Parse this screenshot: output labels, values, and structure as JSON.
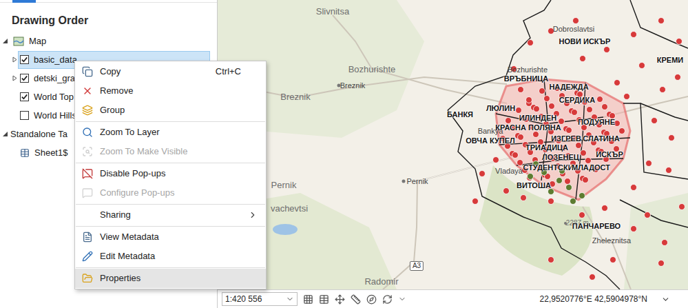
{
  "contents": {
    "title": "Drawing Order",
    "items": [
      {
        "label": "Map",
        "kind": "map",
        "level": 0,
        "expandable": true,
        "expanded": true,
        "selected": false
      },
      {
        "label": "basic_data",
        "kind": "layer",
        "level": 1,
        "expandable": true,
        "expanded": false,
        "checked": true,
        "selected": true
      },
      {
        "label": "detski_grad",
        "kind": "layer",
        "level": 1,
        "expandable": true,
        "expanded": false,
        "checked": true,
        "selected": false
      },
      {
        "label": "World Top",
        "kind": "layer",
        "level": 1,
        "expandable": false,
        "expanded": false,
        "checked": true,
        "selected": false
      },
      {
        "label": "World Hills",
        "kind": "layer",
        "level": 1,
        "expandable": false,
        "expanded": false,
        "checked": false,
        "selected": false
      },
      {
        "label": "Standalone Ta",
        "kind": "group",
        "level": 0,
        "expandable": true,
        "expanded": true,
        "selected": false
      },
      {
        "label": "Sheet1$",
        "kind": "table",
        "level": 1,
        "expandable": false,
        "expanded": false,
        "selected": false
      }
    ]
  },
  "context_menu": {
    "items": [
      {
        "label": "Copy",
        "shortcut": "Ctrl+C",
        "disabled": false,
        "submenu": false,
        "separator_before": false,
        "highlighted": false
      },
      {
        "label": "Remove",
        "shortcut": "",
        "disabled": false,
        "submenu": false,
        "separator_before": false,
        "highlighted": false
      },
      {
        "label": "Group",
        "shortcut": "",
        "disabled": false,
        "submenu": false,
        "separator_before": false,
        "highlighted": false
      },
      {
        "label": "Zoom To Layer",
        "shortcut": "",
        "disabled": false,
        "submenu": false,
        "separator_before": true,
        "highlighted": false
      },
      {
        "label": "Zoom To Make Visible",
        "shortcut": "",
        "disabled": true,
        "submenu": false,
        "separator_before": false,
        "highlighted": false
      },
      {
        "label": "Disable Pop-ups",
        "shortcut": "",
        "disabled": false,
        "submenu": false,
        "separator_before": true,
        "highlighted": false
      },
      {
        "label": "Configure Pop-ups",
        "shortcut": "",
        "disabled": true,
        "submenu": false,
        "separator_before": false,
        "highlighted": false
      },
      {
        "label": "Sharing",
        "shortcut": "",
        "disabled": false,
        "submenu": true,
        "separator_before": true,
        "highlighted": false
      },
      {
        "label": "View Metadata",
        "shortcut": "",
        "disabled": false,
        "submenu": false,
        "separator_before": true,
        "highlighted": false
      },
      {
        "label": "Edit Metadata",
        "shortcut": "",
        "disabled": false,
        "submenu": false,
        "separator_before": false,
        "highlighted": false
      },
      {
        "label": "Properties",
        "shortcut": "",
        "disabled": false,
        "submenu": false,
        "separator_before": true,
        "highlighted": true
      }
    ]
  },
  "map": {
    "labels": [
      {
        "text": "Slivnitsa",
        "kind": "region"
      },
      {
        "text": "Dobroslavtsi",
        "kind": "town"
      },
      {
        "text": "НОВИ ИСКЪР",
        "kind": "district"
      },
      {
        "text": "КРЕМИ",
        "kind": "district"
      },
      {
        "text": "Bozhurishte",
        "kind": "region"
      },
      {
        "text": "Breznik",
        "kind": "town"
      },
      {
        "text": "Bozhurishte",
        "kind": "town"
      },
      {
        "text": "ВРЪБНИЦА",
        "kind": "district"
      },
      {
        "text": "НАДЕЖДА",
        "kind": "district"
      },
      {
        "text": "Breznik",
        "kind": "region"
      },
      {
        "text": "СЕРДИКА",
        "kind": "district"
      },
      {
        "text": "ЛЮЛИН",
        "kind": "district"
      },
      {
        "text": "БАНКЯ",
        "kind": "district"
      },
      {
        "text": "ИЛИНДЕН",
        "kind": "district"
      },
      {
        "text": "ПОДУЯНЕ",
        "kind": "district"
      },
      {
        "text": "КРАСНА ПОЛЯНА",
        "kind": "district"
      },
      {
        "text": "Bankya",
        "kind": "town"
      },
      {
        "text": "ОВЧА КУПЕЛ",
        "kind": "district"
      },
      {
        "text": "ИЗГРЕВ",
        "kind": "district"
      },
      {
        "text": "СЛАТИНА",
        "kind": "district"
      },
      {
        "text": "ТРИАДИЦА",
        "kind": "district"
      },
      {
        "text": "ИСКЪР",
        "kind": "district"
      },
      {
        "text": "ЛОЗЕНЕЦ",
        "kind": "district"
      },
      {
        "text": "СТУДЕНТСКИ",
        "kind": "district"
      },
      {
        "text": "МЛАДОСТ",
        "kind": "district"
      },
      {
        "text": "Vladaya",
        "kind": "town"
      },
      {
        "text": "Pernik",
        "kind": "town"
      },
      {
        "text": "Pernik",
        "kind": "region"
      },
      {
        "text": "ВИТОША",
        "kind": "district"
      },
      {
        "text": "vachevtsi",
        "kind": "region"
      },
      {
        "text": "2287 m",
        "kind": "peak"
      },
      {
        "text": "ПАНЧАРЕВО",
        "kind": "district"
      },
      {
        "text": "Zheleznitsa",
        "kind": "town"
      },
      {
        "text": "A3",
        "kind": "road"
      },
      {
        "text": "Radomir",
        "kind": "region"
      }
    ],
    "point_layers": [
      {
        "color": "#d73a3a"
      },
      {
        "color": "#5d7c30"
      }
    ]
  },
  "status_bar": {
    "scale": "1:420 556",
    "coordinates": "22,9520776°E 42,5904978°N"
  }
}
